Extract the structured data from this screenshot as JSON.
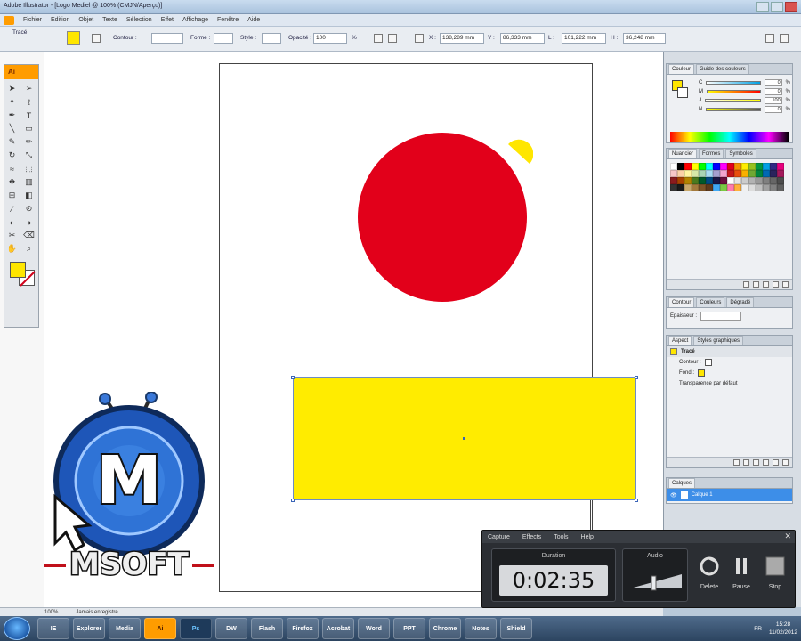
{
  "window": {
    "title": "Adobe Illustrator - [Logo Mediel @ 100% (CMJN/Aperçu)]"
  },
  "menubar": {
    "items": [
      "Fichier",
      "Edition",
      "Objet",
      "Texte",
      "Sélection",
      "Effet",
      "Affichage",
      "Fenêtre",
      "Aide"
    ]
  },
  "controlbar": {
    "object_type": "Tracé",
    "contour_label": "Contour :",
    "forme_label": "Forme :",
    "style_label": "Style :",
    "opacity_label": "Opacité :",
    "opacity_value": "100",
    "opacity_unit": "%",
    "x_label": "X :",
    "x_value": "138,289 mm",
    "y_label": "Y :",
    "y_value": "86,333 mm",
    "w_label": "L :",
    "w_value": "101,222 mm",
    "h_label": "H :",
    "h_value": "36,248 mm",
    "fill_color": "#ffe600"
  },
  "tools": {
    "logo": "Ai",
    "icons": [
      "selection-icon",
      "direct-selection-icon",
      "magic-wand-icon",
      "lasso-icon",
      "pen-icon",
      "type-icon",
      "line-icon",
      "rectangle-icon",
      "paintbrush-icon",
      "pencil-icon",
      "rotate-icon",
      "scale-icon",
      "warp-icon",
      "free-transform-icon",
      "symbol-sprayer-icon",
      "graph-icon",
      "mesh-icon",
      "gradient-icon",
      "eyedropper-icon",
      "blend-icon",
      "live-paint-icon",
      "live-paint-selection-icon",
      "slice-icon",
      "eraser-icon",
      "hand-icon",
      "zoom-icon"
    ]
  },
  "panels": {
    "couleur": {
      "tabs": [
        "Couleur",
        "Guide des couleurs"
      ],
      "channels": [
        {
          "label": "C",
          "value": "0",
          "unit": "%"
        },
        {
          "label": "M",
          "value": "0",
          "unit": "%"
        },
        {
          "label": "J",
          "value": "100",
          "unit": "%"
        },
        {
          "label": "N",
          "value": "0",
          "unit": "%"
        }
      ]
    },
    "nuancier": {
      "tabs": [
        "Nuancier",
        "Formes",
        "Symboles"
      ]
    },
    "contour": {
      "tabs": [
        "Contour",
        "Couleurs",
        "Dégradé"
      ],
      "epaisseur_label": "Epaisseur :"
    },
    "aspect": {
      "tabs": [
        "Aspect",
        "Styles graphiques"
      ],
      "rows": [
        "Tracé",
        "Contour :",
        "Fond :",
        "Transparence par défaut"
      ]
    },
    "calques": {
      "tabs": [
        "Calques"
      ],
      "layer_name": "Calque 1"
    }
  },
  "statusbar": {
    "zoom": "100%",
    "status": "Jamais enregistré"
  },
  "artwork": {
    "circle_color": "#e2001a",
    "rect_color": "#ffec00",
    "semi_color": "#ffe600"
  },
  "watermark": {
    "text": "MSOFT",
    "letter": "M"
  },
  "capture": {
    "menu": [
      "Capture",
      "Effects",
      "Tools",
      "Help"
    ],
    "duration_label": "Duration",
    "duration_value": "0:02:35",
    "audio_label": "Audio",
    "buttons": [
      "Delete",
      "Pause",
      "Stop"
    ]
  },
  "taskbar": {
    "apps": [
      "IE",
      "Explorer",
      "Media",
      "Ai",
      "Ps",
      "DW",
      "Flash",
      "Firefox",
      "Acrobat",
      "Word",
      "PPT",
      "Chrome",
      "Notes",
      "Shield"
    ],
    "lang": "FR",
    "time": "15:28",
    "date": "11/02/2012"
  }
}
